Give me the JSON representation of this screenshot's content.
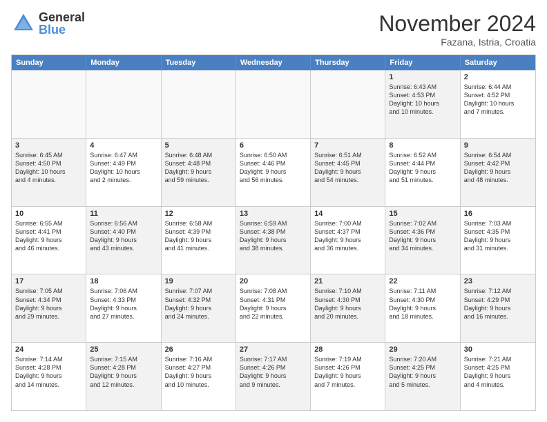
{
  "logo": {
    "general": "General",
    "blue": "Blue"
  },
  "title": "November 2024",
  "location": "Fazana, Istria, Croatia",
  "header_days": [
    "Sunday",
    "Monday",
    "Tuesday",
    "Wednesday",
    "Thursday",
    "Friday",
    "Saturday"
  ],
  "weeks": [
    [
      {
        "day": "",
        "text": "",
        "empty": true
      },
      {
        "day": "",
        "text": "",
        "empty": true
      },
      {
        "day": "",
        "text": "",
        "empty": true
      },
      {
        "day": "",
        "text": "",
        "empty": true
      },
      {
        "day": "",
        "text": "",
        "empty": true
      },
      {
        "day": "1",
        "text": "Sunrise: 6:43 AM\nSunset: 4:53 PM\nDaylight: 10 hours\nand 10 minutes.",
        "shaded": true
      },
      {
        "day": "2",
        "text": "Sunrise: 6:44 AM\nSunset: 4:52 PM\nDaylight: 10 hours\nand 7 minutes.",
        "shaded": false
      }
    ],
    [
      {
        "day": "3",
        "text": "Sunrise: 6:45 AM\nSunset: 4:50 PM\nDaylight: 10 hours\nand 4 minutes.",
        "shaded": true
      },
      {
        "day": "4",
        "text": "Sunrise: 6:47 AM\nSunset: 4:49 PM\nDaylight: 10 hours\nand 2 minutes.",
        "shaded": false
      },
      {
        "day": "5",
        "text": "Sunrise: 6:48 AM\nSunset: 4:48 PM\nDaylight: 9 hours\nand 59 minutes.",
        "shaded": true
      },
      {
        "day": "6",
        "text": "Sunrise: 6:50 AM\nSunset: 4:46 PM\nDaylight: 9 hours\nand 56 minutes.",
        "shaded": false
      },
      {
        "day": "7",
        "text": "Sunrise: 6:51 AM\nSunset: 4:45 PM\nDaylight: 9 hours\nand 54 minutes.",
        "shaded": true
      },
      {
        "day": "8",
        "text": "Sunrise: 6:52 AM\nSunset: 4:44 PM\nDaylight: 9 hours\nand 51 minutes.",
        "shaded": false
      },
      {
        "day": "9",
        "text": "Sunrise: 6:54 AM\nSunset: 4:42 PM\nDaylight: 9 hours\nand 48 minutes.",
        "shaded": true
      }
    ],
    [
      {
        "day": "10",
        "text": "Sunrise: 6:55 AM\nSunset: 4:41 PM\nDaylight: 9 hours\nand 46 minutes.",
        "shaded": false
      },
      {
        "day": "11",
        "text": "Sunrise: 6:56 AM\nSunset: 4:40 PM\nDaylight: 9 hours\nand 43 minutes.",
        "shaded": true
      },
      {
        "day": "12",
        "text": "Sunrise: 6:58 AM\nSunset: 4:39 PM\nDaylight: 9 hours\nand 41 minutes.",
        "shaded": false
      },
      {
        "day": "13",
        "text": "Sunrise: 6:59 AM\nSunset: 4:38 PM\nDaylight: 9 hours\nand 38 minutes.",
        "shaded": true
      },
      {
        "day": "14",
        "text": "Sunrise: 7:00 AM\nSunset: 4:37 PM\nDaylight: 9 hours\nand 36 minutes.",
        "shaded": false
      },
      {
        "day": "15",
        "text": "Sunrise: 7:02 AM\nSunset: 4:36 PM\nDaylight: 9 hours\nand 34 minutes.",
        "shaded": true
      },
      {
        "day": "16",
        "text": "Sunrise: 7:03 AM\nSunset: 4:35 PM\nDaylight: 9 hours\nand 31 minutes.",
        "shaded": false
      }
    ],
    [
      {
        "day": "17",
        "text": "Sunrise: 7:05 AM\nSunset: 4:34 PM\nDaylight: 9 hours\nand 29 minutes.",
        "shaded": true
      },
      {
        "day": "18",
        "text": "Sunrise: 7:06 AM\nSunset: 4:33 PM\nDaylight: 9 hours\nand 27 minutes.",
        "shaded": false
      },
      {
        "day": "19",
        "text": "Sunrise: 7:07 AM\nSunset: 4:32 PM\nDaylight: 9 hours\nand 24 minutes.",
        "shaded": true
      },
      {
        "day": "20",
        "text": "Sunrise: 7:08 AM\nSunset: 4:31 PM\nDaylight: 9 hours\nand 22 minutes.",
        "shaded": false
      },
      {
        "day": "21",
        "text": "Sunrise: 7:10 AM\nSunset: 4:30 PM\nDaylight: 9 hours\nand 20 minutes.",
        "shaded": true
      },
      {
        "day": "22",
        "text": "Sunrise: 7:11 AM\nSunset: 4:30 PM\nDaylight: 9 hours\nand 18 minutes.",
        "shaded": false
      },
      {
        "day": "23",
        "text": "Sunrise: 7:12 AM\nSunset: 4:29 PM\nDaylight: 9 hours\nand 16 minutes.",
        "shaded": true
      }
    ],
    [
      {
        "day": "24",
        "text": "Sunrise: 7:14 AM\nSunset: 4:28 PM\nDaylight: 9 hours\nand 14 minutes.",
        "shaded": false
      },
      {
        "day": "25",
        "text": "Sunrise: 7:15 AM\nSunset: 4:28 PM\nDaylight: 9 hours\nand 12 minutes.",
        "shaded": true
      },
      {
        "day": "26",
        "text": "Sunrise: 7:16 AM\nSunset: 4:27 PM\nDaylight: 9 hours\nand 10 minutes.",
        "shaded": false
      },
      {
        "day": "27",
        "text": "Sunrise: 7:17 AM\nSunset: 4:26 PM\nDaylight: 9 hours\nand 9 minutes.",
        "shaded": true
      },
      {
        "day": "28",
        "text": "Sunrise: 7:19 AM\nSunset: 4:26 PM\nDaylight: 9 hours\nand 7 minutes.",
        "shaded": false
      },
      {
        "day": "29",
        "text": "Sunrise: 7:20 AM\nSunset: 4:25 PM\nDaylight: 9 hours\nand 5 minutes.",
        "shaded": true
      },
      {
        "day": "30",
        "text": "Sunrise: 7:21 AM\nSunset: 4:25 PM\nDaylight: 9 hours\nand 4 minutes.",
        "shaded": false
      }
    ]
  ]
}
